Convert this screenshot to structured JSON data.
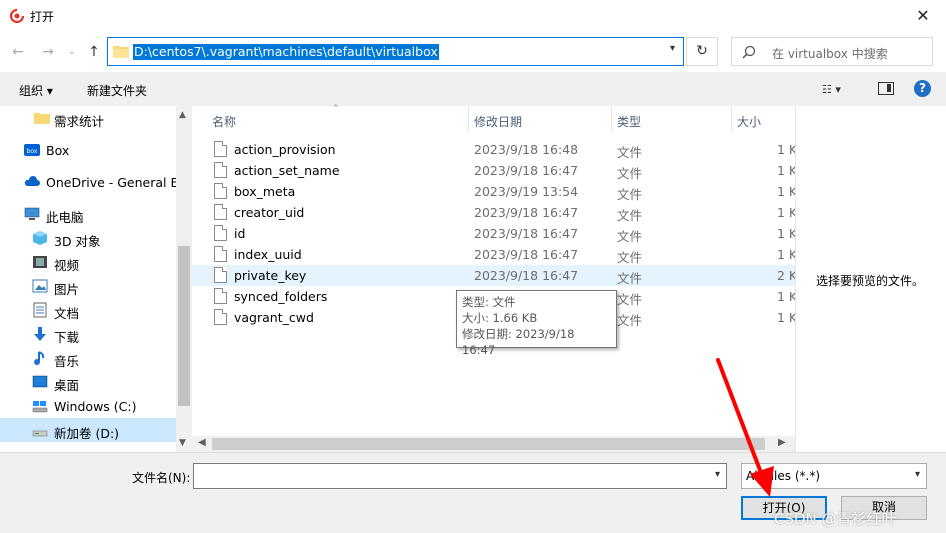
{
  "window": {
    "title": "打开",
    "close_glyph": "✕"
  },
  "nav": {
    "back": "←",
    "forward": "→",
    "recent": "⌄",
    "up": "↑",
    "address": "D:\\centos7\\.vagrant\\machines\\default\\virtualbox",
    "refresh": "↻",
    "search_placeholder": "在 virtualbox 中搜索"
  },
  "toolbar": {
    "organize": "组织 ▾",
    "new_folder": "新建文件夹",
    "help": "?"
  },
  "sidebar": {
    "items": [
      {
        "label": "需求统计",
        "icon": "folder-icon"
      },
      {
        "label": "Box",
        "icon": "box-icon"
      },
      {
        "label": "OneDrive - General Ele",
        "icon": "cloud-icon"
      },
      {
        "label": "此电脑",
        "icon": "computer-icon"
      },
      {
        "label": "3D 对象",
        "icon": "cube-icon"
      },
      {
        "label": "视频",
        "icon": "video-icon"
      },
      {
        "label": "图片",
        "icon": "image-icon"
      },
      {
        "label": "文档",
        "icon": "document-icon"
      },
      {
        "label": "下载",
        "icon": "download-icon"
      },
      {
        "label": "音乐",
        "icon": "music-icon"
      },
      {
        "label": "桌面",
        "icon": "desktop-icon"
      },
      {
        "label": "Windows (C:)",
        "icon": "drive-icon"
      },
      {
        "label": "新加卷 (D:)",
        "icon": "drive-icon"
      }
    ]
  },
  "columns": {
    "name": "名称",
    "modified": "修改日期",
    "type": "类型",
    "size": "大小"
  },
  "files": [
    {
      "name": "action_provision",
      "modified": "2023/9/18 16:48",
      "type": "文件",
      "size": "1 K"
    },
    {
      "name": "action_set_name",
      "modified": "2023/9/18 16:47",
      "type": "文件",
      "size": "1 K"
    },
    {
      "name": "box_meta",
      "modified": "2023/9/19 13:54",
      "type": "文件",
      "size": "1 K"
    },
    {
      "name": "creator_uid",
      "modified": "2023/9/18 16:47",
      "type": "文件",
      "size": "1 K"
    },
    {
      "name": "id",
      "modified": "2023/9/18 16:47",
      "type": "文件",
      "size": "1 K"
    },
    {
      "name": "index_uuid",
      "modified": "2023/9/18 16:47",
      "type": "文件",
      "size": "1 K"
    },
    {
      "name": "private_key",
      "modified": "2023/9/18 16:47",
      "type": "文件",
      "size": "2 K"
    },
    {
      "name": "synced_folders",
      "modified": "",
      "type": "文件",
      "size": "1 K"
    },
    {
      "name": "vagrant_cwd",
      "modified": "",
      "type": "文件",
      "size": "1 K"
    }
  ],
  "preview": {
    "empty_text": "选择要预览的文件。"
  },
  "tooltip": {
    "type": "类型: 文件",
    "size": "大小: 1.66 KB",
    "modified": "修改日期: 2023/9/18 16:47"
  },
  "bottom": {
    "filename_label": "文件名(N):",
    "filename_value": "",
    "filter": "All Files (*.*)",
    "open": "打开(O)",
    "cancel": "取消"
  },
  "watermark": "CSDN @青衫红叶",
  "colors": {
    "accent": "#0078d7",
    "annotation_arrow": "#ff0000"
  }
}
